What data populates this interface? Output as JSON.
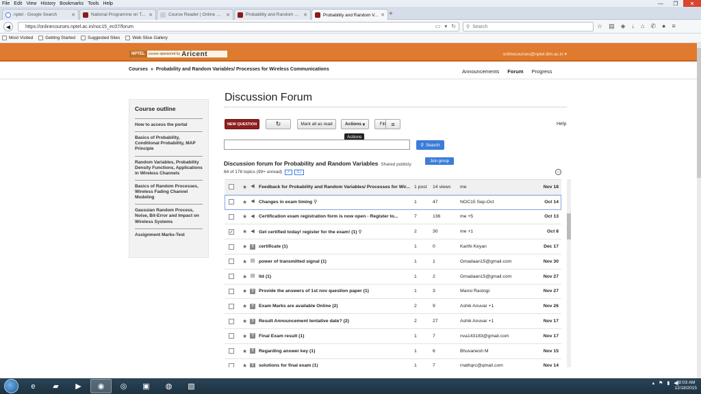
{
  "menubar": [
    "File",
    "Edit",
    "View",
    "History",
    "Bookmarks",
    "Tools",
    "Help"
  ],
  "tabs": [
    {
      "label": "nptel - Google Search",
      "icon": "google-icon"
    },
    {
      "label": "National Programme on Te...",
      "icon": "nptel-favicon"
    },
    {
      "label": "Course Reader | Online Course",
      "icon": "page-icon"
    },
    {
      "label": "Probability and Random Va...",
      "icon": "nptel-favicon"
    },
    {
      "label": "Probability and Random V...",
      "icon": "nptel-favicon",
      "active": true
    }
  ],
  "url": "https://onlinecourses.nptel.ac.in/noc15_ec07/forum",
  "search_placeholder": "Search",
  "bookmarks": [
    "Most Visited",
    "Getting Started",
    "Suggested Sites",
    "Web Slice Gallery"
  ],
  "site": {
    "logo_nptel": "NPTEL",
    "logo_sponsor": "course sponsored by",
    "logo_aricent": "Aricent",
    "user_email": "onlinecourses@nptel.iitm.ac.in",
    "accent_color": "#e07a2e"
  },
  "breadcrumb": {
    "root": "Courses",
    "sep": "»",
    "course": "Probability and Random Variables/ Processes for Wireless Communications"
  },
  "course_tabs": [
    "Announcements",
    "Forum",
    "Progress"
  ],
  "sidebar": {
    "title": "Course outline",
    "items": [
      "How to access the portal",
      "Basics of Probability, Conditional Probability, MAP Principle",
      "Random Variables, Probability Density Functions, Applications in Wireless Channels",
      "Basics of Random Processes, Wireless Fading Channel Modeling",
      "Gaussian Random Process, Noise, Bit-Error and Impact on Wireless Systems",
      "Assignment Marks-Test"
    ]
  },
  "forum": {
    "title": "Discussion Forum",
    "toolbar": {
      "new_question": "NEW QUESTION",
      "mark_all": "Mark all as read",
      "actions": "Actions",
      "filters": "Filters",
      "help": "Help",
      "tooltip": "Actions"
    },
    "search_button": "Search",
    "subtitle": "Discussion forum for Probability and Random Variables",
    "shared": "Shared publicly",
    "join": "Join group",
    "count": "64 of 176 topics (99+ unread)",
    "topics": [
      {
        "subject": "Feedback for Probability and Random Variables/ Processes for Wir...",
        "posts": "1 post",
        "views": "14 views",
        "author": "me",
        "date": "Nov 18",
        "icon": "announce",
        "checked": false
      },
      {
        "subject": "Changes in exam timing",
        "posts": "1",
        "views": "47",
        "author": "NOC15 Sep-Oct",
        "date": "Oct 14",
        "icon": "announce",
        "checked": false,
        "pin": true
      },
      {
        "subject": "Certification exam registration form is now open - Register to...",
        "posts": "7",
        "views": "136",
        "author": "me +5",
        "date": "Oct 13",
        "icon": "announce",
        "checked": false
      },
      {
        "subject": "Get certified today! register for the exam!  (1)",
        "posts": "2",
        "views": "30",
        "author": "me +1",
        "date": "Oct 8",
        "icon": "announce",
        "checked": true,
        "pin": true
      },
      {
        "subject": "certificate  (1)",
        "posts": "1",
        "views": "0",
        "author": "Karthi Keyan",
        "date": "Dec 17",
        "icon": "question",
        "checked": false
      },
      {
        "subject": "power of transmitted signal  (1)",
        "posts": "1",
        "views": "1",
        "author": "Gmadaan15@gmail.com",
        "date": "Nov 30",
        "icon": "discussion",
        "checked": false
      },
      {
        "subject": "lld  (1)",
        "posts": "1",
        "views": "2",
        "author": "Gmadaan15@gmail.com",
        "date": "Nov 27",
        "icon": "discussion",
        "checked": false
      },
      {
        "subject": "Provide the answers of 1st nov question paper  (1)",
        "posts": "1",
        "views": "3",
        "author": "Mansi Rastogi",
        "date": "Nov 27",
        "icon": "question",
        "checked": false
      },
      {
        "subject": "Exam Marks are available Online  (2)",
        "posts": "2",
        "views": "9",
        "author": "Ashik Anuvar +1",
        "date": "Nov 26",
        "icon": "question",
        "checked": false
      },
      {
        "subject": "Result Announcement tentative date?  (2)",
        "posts": "2",
        "views": "27",
        "author": "Ashik Anuvar +1",
        "date": "Nov 17",
        "icon": "question",
        "checked": false
      },
      {
        "subject": "Final Exam result  (1)",
        "posts": "1",
        "views": "7",
        "author": "nva143183@gmail.com",
        "date": "Nov 17",
        "icon": "question",
        "checked": false
      },
      {
        "subject": "Regarding answer key  (1)",
        "posts": "1",
        "views": "6",
        "author": "Bhuvanesh M",
        "date": "Nov 15",
        "icon": "question",
        "checked": false
      },
      {
        "subject": "solutions for final exam  (1)",
        "posts": "1",
        "views": "7",
        "author": "rnathgrc@gmail.com",
        "date": "Nov 14",
        "icon": "question",
        "checked": false
      }
    ]
  },
  "taskbar": {
    "clock_time": "10:03 AM",
    "clock_date": "12/18/2015"
  }
}
